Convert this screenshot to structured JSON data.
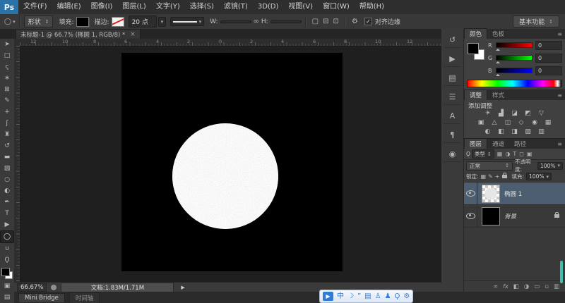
{
  "app": {
    "logo": "Ps"
  },
  "glyphs": {
    "caret": "▾",
    "check": "✓",
    "menu": "≡",
    "updown": "↕",
    "gear": "⚙",
    "link": "∞",
    "play": "▶",
    "search": "Ϙ"
  },
  "menubar": {
    "items": [
      "文件(F)",
      "编辑(E)",
      "图像(I)",
      "图层(L)",
      "文字(Y)",
      "选择(S)",
      "滤镜(T)",
      "3D(D)",
      "视图(V)",
      "窗口(W)",
      "帮助(H)"
    ]
  },
  "options": {
    "tool_preset_glyph": "◯",
    "mode": "形状",
    "fill_label": "填充:",
    "stroke_label": "描边:",
    "stroke_size": "20 点",
    "w_label": "W:",
    "h_label": "H:",
    "path_ops": [
      "▢",
      "⊟",
      "⊡"
    ],
    "align_edges_label": "对齐边缘",
    "workspace": "基本功能"
  },
  "tabbar": {
    "title": "未标题-1 @ 66.7% (椭圆 1, RGB/8) *",
    "close_glyph": "×"
  },
  "ruler": {
    "numbers": [
      "12",
      "10",
      "8",
      "6",
      "4",
      "2",
      "0",
      "2",
      "4",
      "6",
      "8",
      "10",
      "12"
    ]
  },
  "toolbar": {
    "tools": [
      {
        "name": "move-tool",
        "glyph": "➤"
      },
      {
        "name": "marquee-tool",
        "glyph": "□"
      },
      {
        "name": "lasso-tool",
        "glyph": "ς"
      },
      {
        "name": "quick-selection-tool",
        "glyph": "∗"
      },
      {
        "name": "crop-tool",
        "glyph": "⊞"
      },
      {
        "name": "eyedropper-tool",
        "glyph": "✎"
      },
      {
        "name": "healing-brush-tool",
        "glyph": "+"
      },
      {
        "name": "brush-tool",
        "glyph": "ʃ"
      },
      {
        "name": "clone-stamp-tool",
        "glyph": "♜"
      },
      {
        "name": "history-brush-tool",
        "glyph": "↺"
      },
      {
        "name": "eraser-tool",
        "glyph": "▬"
      },
      {
        "name": "gradient-tool",
        "glyph": "▧"
      },
      {
        "name": "blur-tool",
        "glyph": "○"
      },
      {
        "name": "dodge-tool",
        "glyph": "◐"
      },
      {
        "name": "pen-tool",
        "glyph": "✒"
      },
      {
        "name": "type-tool",
        "glyph": "T"
      },
      {
        "name": "path-selection-tool",
        "glyph": "▶"
      },
      {
        "name": "ellipse-tool",
        "glyph": "◯"
      },
      {
        "name": "hand-tool",
        "glyph": "∪"
      },
      {
        "name": "zoom-tool",
        "glyph": "Ϙ"
      }
    ],
    "quick_mask_glyph": "▣",
    "screen_mode_glyph": "▤"
  },
  "dock_icons": [
    {
      "name": "history-panel",
      "glyph": "↺"
    },
    {
      "name": "actions-panel",
      "glyph": "▶"
    },
    {
      "name": "properties-panel",
      "glyph": "▤"
    },
    {
      "name": "info-panel",
      "glyph": "☰"
    },
    {
      "name": "character-panel",
      "glyph": "A"
    },
    {
      "name": "paragraph-panel",
      "glyph": "¶"
    },
    {
      "name": "kuler-panel",
      "glyph": "◉"
    }
  ],
  "panels": {
    "color": {
      "tabs": [
        "颜色",
        "色板"
      ],
      "channels": [
        {
          "label": "R",
          "value": "0"
        },
        {
          "label": "G",
          "value": "0"
        },
        {
          "label": "B",
          "value": "0"
        }
      ]
    },
    "adjustments": {
      "tabs": [
        "调整",
        "样式"
      ],
      "title": "添加调整",
      "rows": [
        [
          "☀",
          "▟",
          "◪",
          "◩",
          "▽"
        ],
        [
          "▣",
          "△",
          "◫",
          "◇",
          "◉",
          "▦"
        ],
        [
          "◐",
          "◧",
          "◨",
          "▨",
          "▥"
        ]
      ]
    },
    "layers": {
      "tabs": [
        "图层",
        "通道",
        "路径"
      ],
      "filter_label": "类型",
      "filter_icons": [
        "▦",
        "◑",
        "T",
        "◻",
        "▣"
      ],
      "blend_mode": "正常",
      "opacity_label": "不透明度:",
      "opacity": "100%",
      "lock_label": "锁定:",
      "lock_icons": [
        "▦",
        "✎",
        "+"
      ],
      "fill_label": "填充:",
      "fill": "100%",
      "items": [
        {
          "name": "椭圆 1"
        },
        {
          "name": "背景"
        }
      ],
      "bottom_icons": [
        "∞",
        "fx",
        "◧",
        "◑",
        "▭",
        "▫",
        "▥"
      ]
    }
  },
  "statusbar": {
    "zoom": "66.67%",
    "doc": "文档:1.83M/1.71M"
  },
  "bottombar": {
    "tabs": [
      "Mini Bridge",
      "时间轴"
    ]
  },
  "ime": {
    "icons": [
      {
        "name": "ime-mode-chinese",
        "glyph": "中"
      },
      {
        "name": "ime-halfmoon",
        "glyph": "☽"
      },
      {
        "name": "ime-punctuation",
        "glyph": "”"
      },
      {
        "name": "ime-soft-keyboard",
        "glyph": "▤"
      },
      {
        "name": "ime-skin",
        "glyph": "♙"
      },
      {
        "name": "ime-account",
        "glyph": "♟"
      },
      {
        "name": "ime-search",
        "glyph": "Ϙ"
      },
      {
        "name": "ime-settings",
        "glyph": "⚙"
      }
    ]
  }
}
